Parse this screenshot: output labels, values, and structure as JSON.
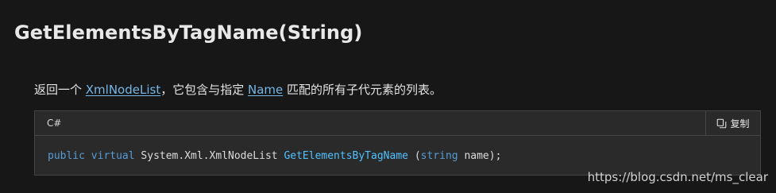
{
  "page": {
    "title": "GetElementsByTagName(String)"
  },
  "summary": {
    "text_before": "返回一个 ",
    "link_1": "XmlNodeList",
    "text_middle": "，它包含与指定 ",
    "link_2": "Name",
    "text_after": " 匹配的所有子代元素的列表。"
  },
  "code": {
    "language": "C#",
    "copy_label": "复制",
    "copy_icon": "copy-icon",
    "tokens": {
      "kw_public": "public",
      "kw_virtual": "virtual",
      "type": "System.Xml.XmlNodeList",
      "method": "GetElementsByTagName",
      "paren_open": "(",
      "kw_string": "string",
      "param_tail": "name);"
    }
  },
  "watermark": "https://blog.csdn.net/ms_clear",
  "colors": {
    "background": "#171717",
    "link": "#75b6e7",
    "keyword": "#569cd6",
    "method": "#4fc1ff"
  }
}
